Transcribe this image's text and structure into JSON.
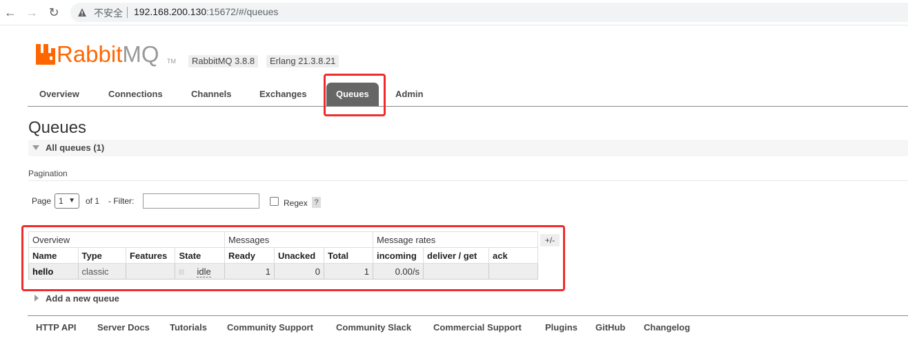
{
  "browser": {
    "back_icon": "←",
    "forward_icon": "→",
    "reload_icon": "↻",
    "insecure_label": "不安全",
    "url_host": "192.168.200.130",
    "url_rest": ":15672/#/queues"
  },
  "logo": {
    "rabbit": "Rabbit",
    "mq": "MQ",
    "tm": "TM"
  },
  "versions": {
    "rabbitmq": "RabbitMQ 3.8.8",
    "erlang": "Erlang 21.3.8.21"
  },
  "tabs": [
    "Overview",
    "Connections",
    "Channels",
    "Exchanges",
    "Queues",
    "Admin"
  ],
  "active_tab": "Queues",
  "page_title": "Queues",
  "all_queues_label": "All queues (1)",
  "pagination": {
    "label": "Pagination",
    "page_label": "Page",
    "page_value": "1",
    "of_label": "of 1",
    "filter_label": "- Filter:",
    "filter_value": "",
    "regex_label": "Regex",
    "help": "?"
  },
  "table": {
    "groups": [
      "Overview",
      "Messages",
      "Message rates"
    ],
    "columns": [
      "Name",
      "Type",
      "Features",
      "State",
      "Ready",
      "Unacked",
      "Total",
      "incoming",
      "deliver / get",
      "ack"
    ],
    "rows": [
      {
        "name": "hello",
        "type": "classic",
        "features": "",
        "state": "idle",
        "ready": "1",
        "unacked": "0",
        "total": "1",
        "incoming": "0.00/s",
        "deliver_get": "",
        "ack": ""
      }
    ],
    "toggle_columns": "+/-"
  },
  "add_queue_label": "Add a new queue",
  "footer": [
    "HTTP API",
    "Server Docs",
    "Tutorials",
    "Community Support",
    "Community Slack",
    "Commercial Support",
    "Plugins",
    "GitHub",
    "Changelog"
  ],
  "colors": {
    "brand_orange": "#ff6600",
    "highlight_red": "#ef2b2b",
    "active_tab": "#666666"
  }
}
